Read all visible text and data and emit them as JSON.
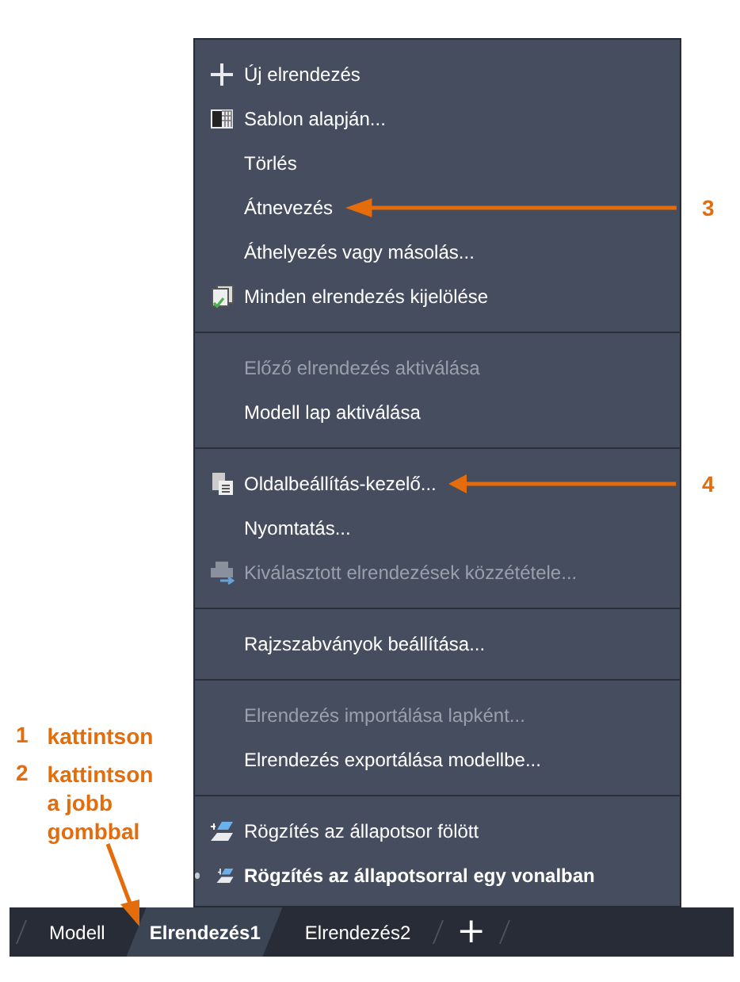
{
  "menu": {
    "groups": [
      {
        "items": [
          {
            "label": "Új elrendezés",
            "kind": "plus",
            "disabled": false
          },
          {
            "label": "Sablon alapján...",
            "kind": "template",
            "disabled": false
          },
          {
            "label": "Törlés",
            "disabled": false
          },
          {
            "label": "Átnevezés",
            "disabled": false,
            "callout": "3"
          },
          {
            "label": "Áthelyezés vagy másolás...",
            "disabled": false
          },
          {
            "label": "Minden elrendezés kijelölése",
            "kind": "select-all",
            "disabled": false
          }
        ]
      },
      {
        "items": [
          {
            "label": "Előző elrendezés aktiválása",
            "disabled": true
          },
          {
            "label": "Modell lap aktiválása",
            "disabled": false
          }
        ]
      },
      {
        "items": [
          {
            "label": "Oldalbeállítás-kezelő...",
            "kind": "page-setup",
            "disabled": false,
            "callout": "4"
          },
          {
            "label": "Nyomtatás...",
            "disabled": false
          },
          {
            "label": "Kiválasztott elrendezések közzététele...",
            "kind": "publish",
            "disabled": true
          }
        ]
      },
      {
        "items": [
          {
            "label": "Rajzszabványok beállítása...",
            "disabled": false
          }
        ]
      },
      {
        "items": [
          {
            "label": "Elrendezés importálása lapként...",
            "disabled": true
          },
          {
            "label": "Elrendezés exportálása modellbe...",
            "disabled": false
          }
        ]
      },
      {
        "items": [
          {
            "label": "Rögzítés az állapotsor fölött",
            "kind": "dock-above",
            "disabled": false,
            "selected": false
          },
          {
            "label": "Rögzítés az állapotsorral egy vonalban",
            "kind": "dock-inline",
            "disabled": false,
            "selected": true
          }
        ]
      }
    ]
  },
  "tabs": [
    {
      "label": "Modell",
      "selected": false
    },
    {
      "label": "Elrendezés1",
      "selected": true
    },
    {
      "label": "Elrendezés2",
      "selected": false
    }
  ],
  "add_tab": "+",
  "steps": [
    {
      "number": "1",
      "text": "kattintson"
    },
    {
      "number": "2",
      "text": "kattintson a jobb gombbal"
    }
  ]
}
